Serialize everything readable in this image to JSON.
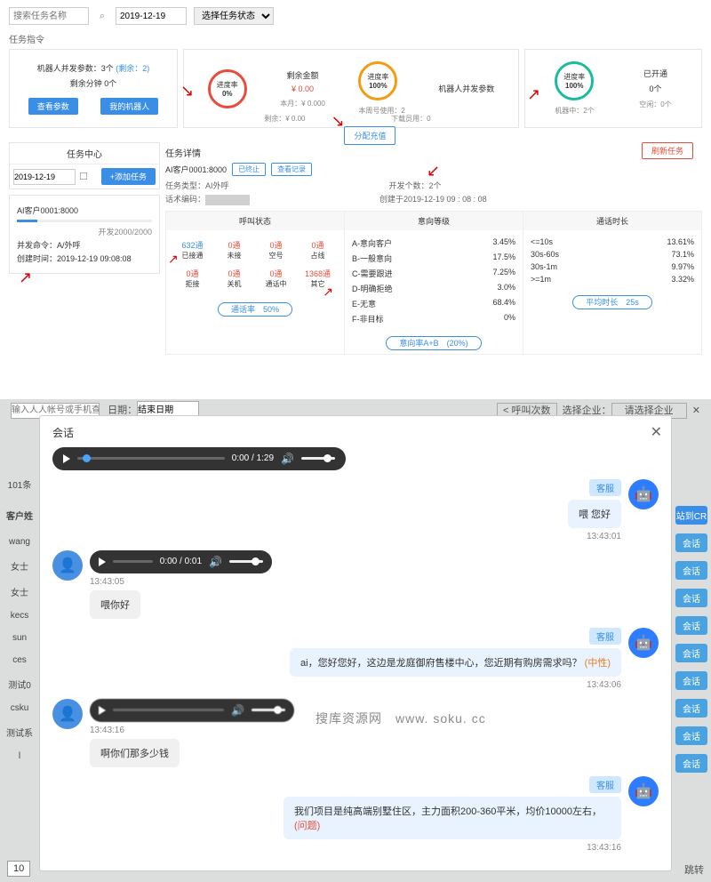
{
  "filters": {
    "keyword_ph": "搜索任务名称",
    "date": "2019-12-19",
    "status_ph": "选择任务状态"
  },
  "section_label": "任务指令",
  "card1": {
    "line1a": "机器人并发参数：3个",
    "line1b": "(剩余：2)",
    "line2": "剩余分钟 0个",
    "btn1": "查看参数",
    "btn2": "我的机器人"
  },
  "ring1": {
    "label": "进度率",
    "value": "0%"
  },
  "ring2": {
    "label": "进度率",
    "value": "100%"
  },
  "ring3": {
    "label": "进度率",
    "value": "100%"
  },
  "stats": {
    "a": {
      "label": "剩余金额",
      "value": "¥ 0.00",
      "sub1": "本月：¥ 0.000",
      "sub2": "剩余：¥ 0.00"
    },
    "b": {
      "label": "本周号使用：2",
      "sub": "下载员用：0"
    },
    "c": {
      "label": "机器人并发参数",
      "sub": ""
    },
    "d": {
      "label": "已开通",
      "value": "0个",
      "sub1": "机器中：2个",
      "sub2": "空闲：0个"
    }
  },
  "assign_btn": "分配充值",
  "task_center": "任务中心",
  "task_date": "2019-12-19",
  "add_task": "+添加任务",
  "ti": {
    "name": "AI客户0001:8000",
    "prog_text": "开发2000/2000",
    "l1": "并发命令：A/外呼",
    "l2": "创建时间：2019-12-19 09:08:08"
  },
  "detail": {
    "title": "任务详情",
    "refresh": "刷新任务",
    "tag": "AI客户0001:8000",
    "b1": "已终止",
    "b2": "查看记录",
    "m1_label": "任务类型：",
    "m1_val": "AI外呼",
    "m1_r": "开发个数：2个",
    "m2_label": "话术编码：",
    "m2_r": "创建于2019-12-19 09 : 08 : 08"
  },
  "cols": {
    "c1": "呼叫状态",
    "c2": "意向等级",
    "c3": "通话时长"
  },
  "status": [
    {
      "n": "632通",
      "l": "已接通",
      "blue": true
    },
    {
      "n": "0通",
      "l": "未接"
    },
    {
      "n": "0通",
      "l": "空号"
    },
    {
      "n": "0通",
      "l": "占线"
    },
    {
      "n": "0通",
      "l": "拒接"
    },
    {
      "n": "0通",
      "l": "关机"
    },
    {
      "n": "0通",
      "l": "通话中"
    },
    {
      "n": "1368通",
      "l": "其它"
    }
  ],
  "intent": [
    {
      "k": "A-意向客户",
      "v": "3.45%"
    },
    {
      "k": "B-一般意向",
      "v": "17.5%"
    },
    {
      "k": "C-需要跟进",
      "v": "7.25%"
    },
    {
      "k": "D-明确拒绝",
      "v": "3.0%"
    },
    {
      "k": "E-无意",
      "v": "68.4%"
    },
    {
      "k": "F-非目标",
      "v": "0%"
    }
  ],
  "dur": [
    {
      "k": "<=10s",
      "v": "13.61%"
    },
    {
      "k": "30s-60s",
      "v": "73.1%"
    },
    {
      "k": "30s-1m",
      "v": "9.97%"
    },
    {
      "k": ">=1m",
      "v": "3.32%"
    }
  ],
  "fb1": "通话率　50%",
  "fb2": "意向率A+B　(20%)",
  "fb3": "平均时长　25s",
  "bg": {
    "search_ph": "输入人人帐号或手机查找",
    "date_label": "日期：",
    "date_val": "结束日期",
    "sort": "< 呼叫次数",
    "org_label": "选择企业：",
    "org_val": "请选择企业",
    "count": "101条",
    "cust_name": "客户姓",
    "names": [
      "wang",
      "女士",
      "女士",
      "kecs",
      "sun",
      "ces",
      "测试0",
      "csku",
      "测试系",
      "l"
    ],
    "right_btn": "站到CR",
    "tag": "会话",
    "page": "10",
    "foot": "跳转"
  },
  "modal": {
    "title": "会话",
    "a1_time": "0:00 / 1:29",
    "a2_time": "0:00 / 0:01",
    "bot_role": "客服",
    "cust_role": "客服",
    "m1": {
      "text": "喂 您好",
      "ts": "13:43:01"
    },
    "m2": {
      "text": "喂你好",
      "ts": "13:43:05"
    },
    "m3": {
      "text": "ai，您好您好，这边是龙庭御府售楼中心，您近期有购房需求吗？",
      "sent": "(中性)",
      "ts": "13:43:06"
    },
    "m4": {
      "text": "啊你们那多少钱",
      "ts": "13:43:16"
    },
    "m5": {
      "text": "我们项目是纯高端别墅住区，主力面积200-360平米，均价10000左右，",
      "sent": "(问题)",
      "ts": "13:43:16"
    }
  },
  "watermark": "搜库资源网　www. soku. cc"
}
